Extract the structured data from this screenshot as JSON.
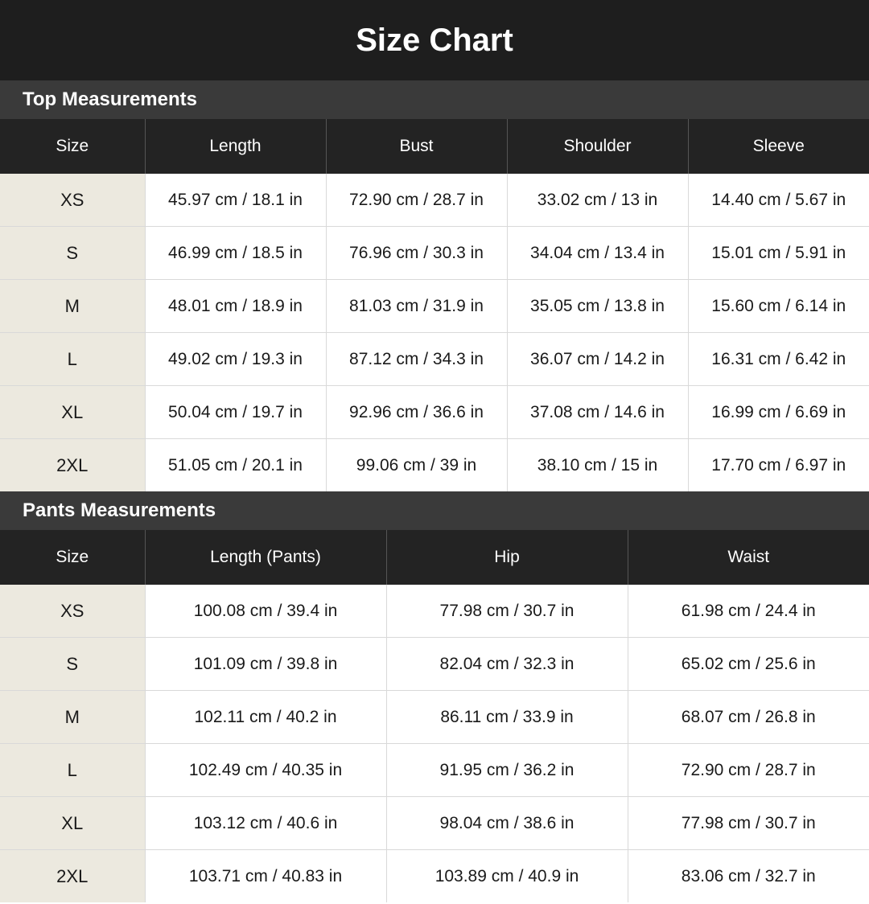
{
  "title": "Size Chart",
  "top": {
    "section_title": "Top Measurements",
    "headers": [
      "Size",
      "Length",
      "Bust",
      "Shoulder",
      "Sleeve"
    ],
    "rows": [
      [
        "XS",
        "45.97 cm / 18.1 in",
        "72.90 cm / 28.7 in",
        "33.02 cm / 13 in",
        "14.40 cm / 5.67 in"
      ],
      [
        "S",
        "46.99 cm / 18.5 in",
        "76.96 cm / 30.3 in",
        "34.04 cm / 13.4 in",
        "15.01 cm / 5.91 in"
      ],
      [
        "M",
        "48.01 cm / 18.9 in",
        "81.03 cm / 31.9 in",
        "35.05 cm / 13.8 in",
        "15.60 cm / 6.14 in"
      ],
      [
        "L",
        "49.02 cm / 19.3 in",
        "87.12 cm / 34.3 in",
        "36.07 cm / 14.2 in",
        "16.31 cm / 6.42 in"
      ],
      [
        "XL",
        "50.04 cm / 19.7 in",
        "92.96 cm / 36.6 in",
        "37.08 cm / 14.6 in",
        "16.99 cm / 6.69 in"
      ],
      [
        "2XL",
        "51.05 cm / 20.1 in",
        "99.06 cm / 39 in",
        "38.10 cm / 15 in",
        "17.70 cm / 6.97 in"
      ]
    ]
  },
  "pants": {
    "section_title": "Pants Measurements",
    "headers": [
      "Size",
      "Length (Pants)",
      "Hip",
      "Waist"
    ],
    "rows": [
      [
        "XS",
        "100.08 cm / 39.4 in",
        "77.98 cm / 30.7 in",
        "61.98 cm / 24.4 in"
      ],
      [
        "S",
        "101.09 cm / 39.8 in",
        "82.04 cm / 32.3 in",
        "65.02 cm / 25.6 in"
      ],
      [
        "M",
        "102.11 cm / 40.2 in",
        "86.11 cm / 33.9 in",
        "68.07 cm / 26.8 in"
      ],
      [
        "L",
        "102.49 cm / 40.35 in",
        "91.95 cm / 36.2 in",
        "72.90 cm / 28.7 in"
      ],
      [
        "XL",
        "103.12 cm / 40.6 in",
        "98.04 cm / 38.6 in",
        "77.98 cm / 30.7 in"
      ],
      [
        "2XL",
        "103.71 cm / 40.83 in",
        "103.89 cm / 40.9 in",
        "83.06 cm / 32.7 in"
      ]
    ]
  },
  "colors": {
    "title_bg": "#1e1e1e",
    "section_bg": "#3a3a3a",
    "header_bg": "#232323",
    "size_col_bg": "#ece9df"
  }
}
